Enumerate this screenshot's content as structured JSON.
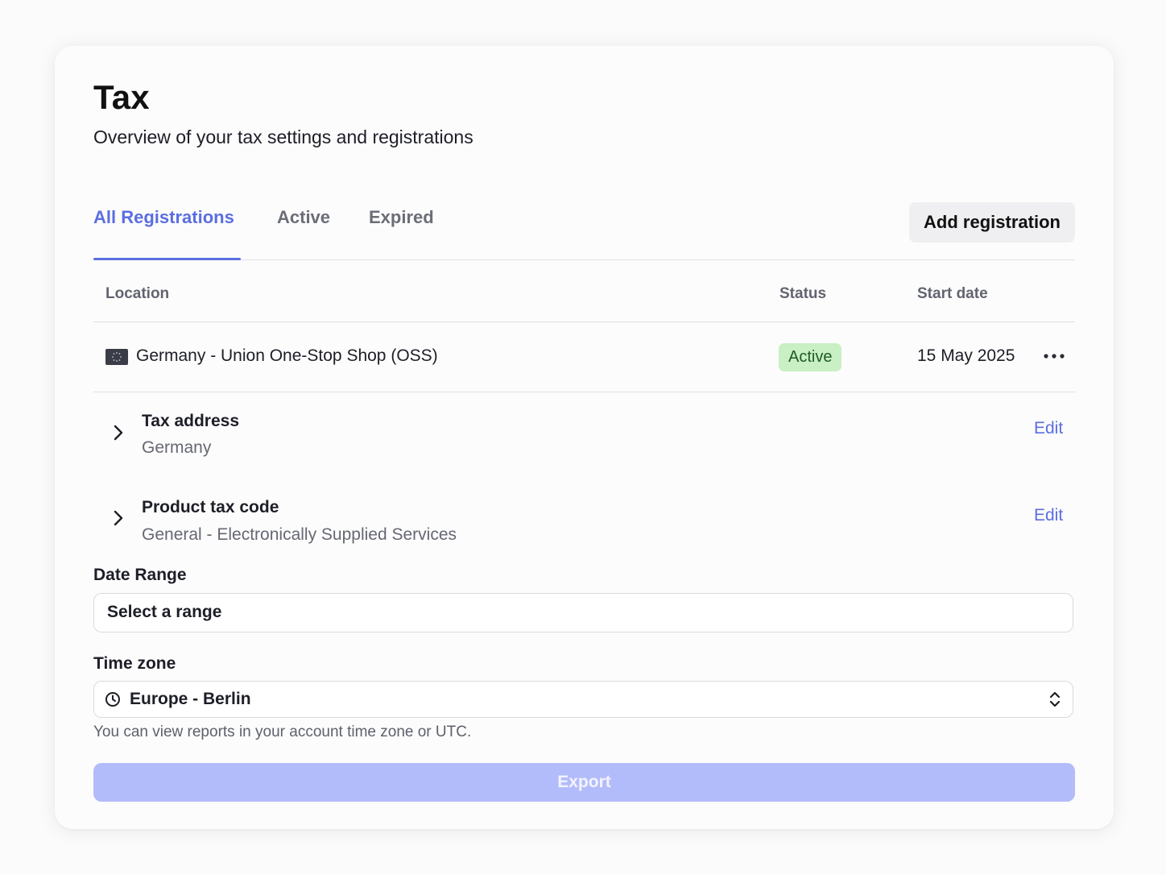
{
  "header": {
    "title": "Tax",
    "subtitle": "Overview of your tax settings and registrations"
  },
  "tabs": [
    {
      "label": "All Registrations",
      "active": true
    },
    {
      "label": "Active",
      "active": false
    },
    {
      "label": "Expired",
      "active": false
    }
  ],
  "toolbar": {
    "add_label": "Add registration"
  },
  "table": {
    "columns": [
      "Location",
      "Status",
      "Start date"
    ],
    "rows": [
      {
        "flag_icon": "eu-flag-icon",
        "location": "Germany - Union One-Stop Shop (OSS)",
        "status": "Active",
        "start_date": "15 May 2025"
      }
    ]
  },
  "details": [
    {
      "title": "Tax address",
      "value": "Germany",
      "action": "Edit"
    },
    {
      "title": "Product tax code",
      "value": "General - Electronically Supplied Services",
      "action": "Edit"
    }
  ],
  "date_range": {
    "label": "Date Range",
    "placeholder": "Select a range"
  },
  "time_zone": {
    "label": "Time zone",
    "value": "Europe - Berlin",
    "help": "You can view reports in your account time zone or UTC."
  },
  "export": {
    "label": "Export"
  },
  "colors": {
    "accent": "#5b6ee1",
    "badge_bg": "#c9f0c4",
    "export_bg": "#b3bcfa"
  }
}
